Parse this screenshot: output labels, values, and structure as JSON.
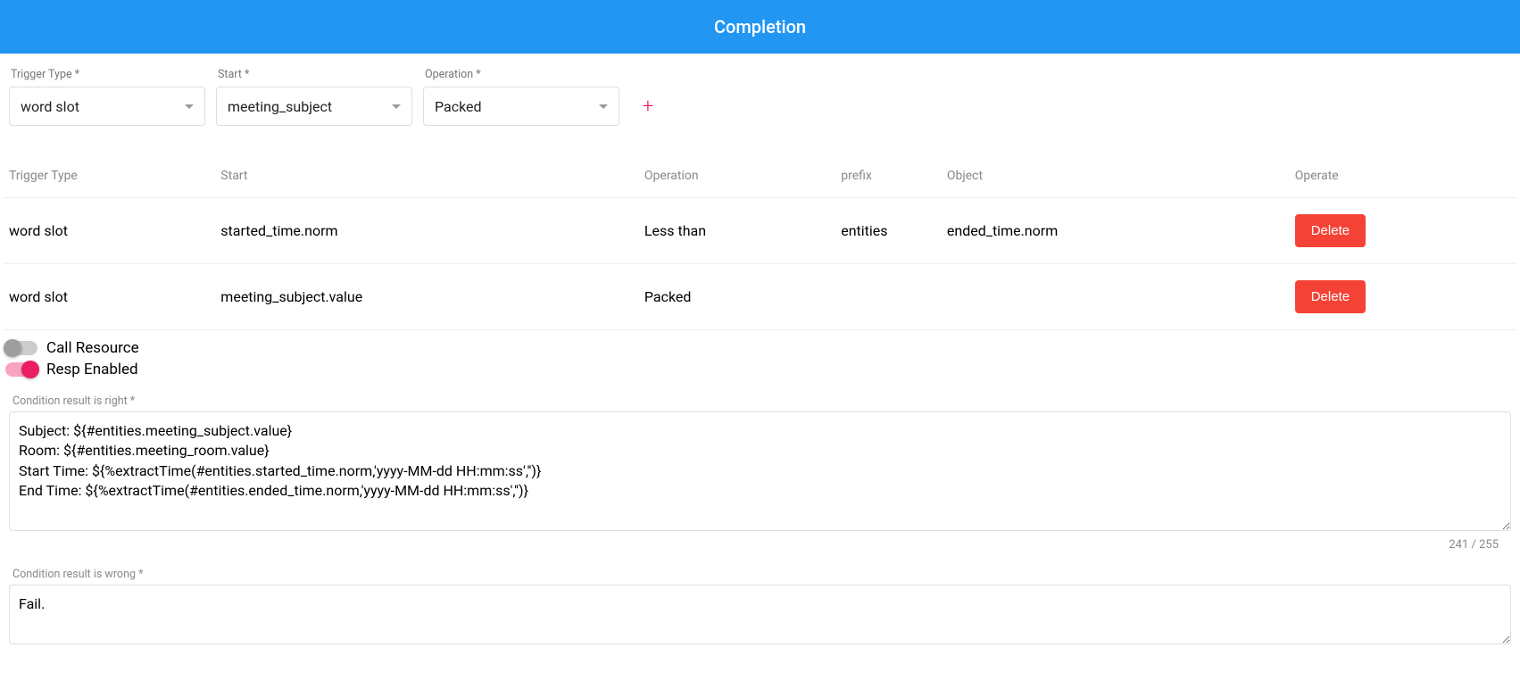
{
  "header": {
    "title": "Completion"
  },
  "form": {
    "triggerType": {
      "label": "Trigger Type *",
      "value": "word slot"
    },
    "start": {
      "label": "Start *",
      "value": "meeting_subject"
    },
    "operation": {
      "label": "Operation *",
      "value": "Packed"
    }
  },
  "addBtn": "+",
  "table": {
    "headers": {
      "triggerType": "Trigger Type",
      "start": "Start",
      "operation": "Operation",
      "prefix": "prefix",
      "object": "Object",
      "operate": "Operate"
    },
    "rows": [
      {
        "triggerType": "word slot",
        "start": "started_time.norm",
        "operation": "Less than",
        "prefix": "entities",
        "object": "ended_time.norm",
        "delete": "Delete"
      },
      {
        "triggerType": "word slot",
        "start": "meeting_subject.value",
        "operation": "Packed",
        "prefix": "",
        "object": "",
        "delete": "Delete"
      }
    ]
  },
  "toggles": {
    "callResource": {
      "label": "Call Resource",
      "on": false
    },
    "respEnabled": {
      "label": "Resp Enabled",
      "on": true
    }
  },
  "conditionRight": {
    "label": "Condition result is right *",
    "value": "Subject: ${#entities.meeting_subject.value}\nRoom: ${#entities.meeting_room.value}\nStart Time: ${%extractTime(#entities.started_time.norm,'yyyy-MM-dd HH:mm:ss','')}\nEnd Time: ${%extractTime(#entities.ended_time.norm,'yyyy-MM-dd HH:mm:ss','')}",
    "count": "241 / 255"
  },
  "conditionWrong": {
    "label": "Condition result is wrong *",
    "value": "Fail."
  }
}
